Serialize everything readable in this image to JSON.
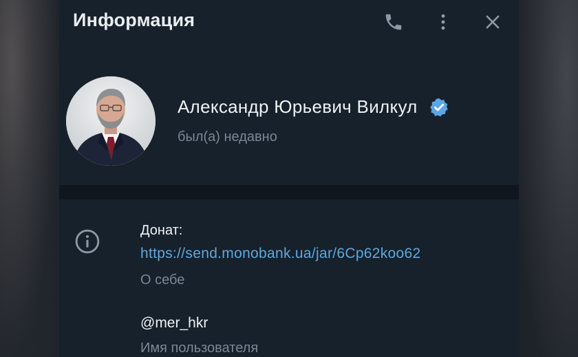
{
  "header": {
    "title": "Информация",
    "phone_icon": "phone-icon",
    "more_icon": "more-vertical-icon",
    "close_icon": "close-icon"
  },
  "profile": {
    "name": "Александр Юрьевич Вилкул",
    "status": "был(а) недавно",
    "verified_icon": "verified-badge-icon",
    "verified_color": "#5ba7e5"
  },
  "about": {
    "icon": "info-icon",
    "text_label": "Донат:",
    "link": "https://send.monobank.ua/jar/6Cp62koo62",
    "caption": "О себе"
  },
  "username": {
    "value": "@mer_hkr",
    "caption": "Имя пользователя"
  },
  "colors": {
    "panel_bg": "#17212b",
    "accent_link": "#5fa8de",
    "primary_text": "#eef2f5",
    "secondary_text": "#7a8794"
  }
}
